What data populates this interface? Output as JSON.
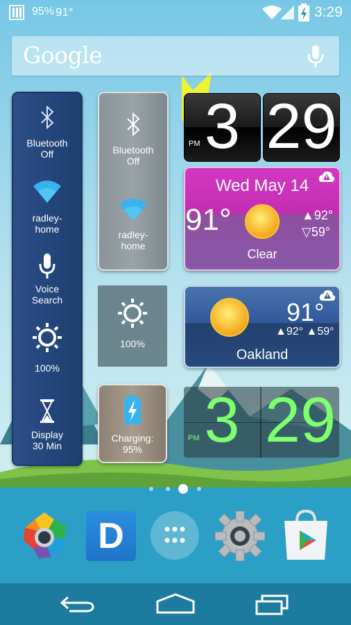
{
  "status_bar": {
    "battery_text": "95%",
    "temperature": "91°",
    "time": "3:29"
  },
  "search": {
    "logo_text": "Google",
    "icons": [
      "microphone-icon"
    ]
  },
  "toggles_blue": [
    {
      "label_line1": "Bluetooth",
      "label_line2": "Off",
      "icon": "bluetooth-icon"
    },
    {
      "label_line1": "radley-",
      "label_line2": "home",
      "icon": "wifi-icon"
    },
    {
      "label_line1": "Voice",
      "label_line2": "Search",
      "icon": "microphone-icon"
    },
    {
      "label_line1": "100%",
      "label_line2": "",
      "icon": "brightness-icon"
    },
    {
      "label_line1": "Display",
      "label_line2": "30 Min",
      "icon": "hourglass-icon"
    }
  ],
  "toggles_grey": [
    {
      "label_line1": "Bluetooth",
      "label_line2": "Off",
      "icon": "bluetooth-icon"
    },
    {
      "label_line1": "radley-",
      "label_line2": "home",
      "icon": "wifi-icon"
    }
  ],
  "brightness_widget": {
    "label": "100%",
    "icon": "brightness-icon"
  },
  "battery_widget": {
    "label_line1": "Charging:",
    "label_line2": "95%",
    "icon": "battery-charging-icon"
  },
  "clock_top": {
    "hour": "3",
    "minute": "29",
    "ampm": "PM"
  },
  "weather_pink": {
    "date": "Wed May 14",
    "temp": "91°",
    "high": "▲92°",
    "low": "▽59°",
    "condition": "Clear",
    "icon": "sun-icon",
    "alert_icon": "weather-alert-icon"
  },
  "weather_blue": {
    "temp": "91°",
    "high_low": "▲92° ▲59°",
    "location": "Oakland",
    "icon": "sun-icon",
    "alert_icon": "weather-alert-icon"
  },
  "clock_bottom": {
    "hour": "3",
    "minute": "29",
    "ampm": "PM",
    "color": "#7dff6e"
  },
  "page_indicator": {
    "pages": 4,
    "current": 3
  },
  "dock": [
    {
      "name": "photos-app-icon"
    },
    {
      "name": "dashclock-app-icon",
      "letter": "D"
    },
    {
      "name": "app-drawer-icon"
    },
    {
      "name": "settings-app-icon"
    },
    {
      "name": "play-store-app-icon"
    }
  ],
  "navbar": [
    "back-icon",
    "home-icon",
    "recents-icon"
  ],
  "colors": {
    "dock_bg": "#2a9bc4",
    "pink_widget": "#c32cb2",
    "blue_widget": "#2b4e86"
  }
}
